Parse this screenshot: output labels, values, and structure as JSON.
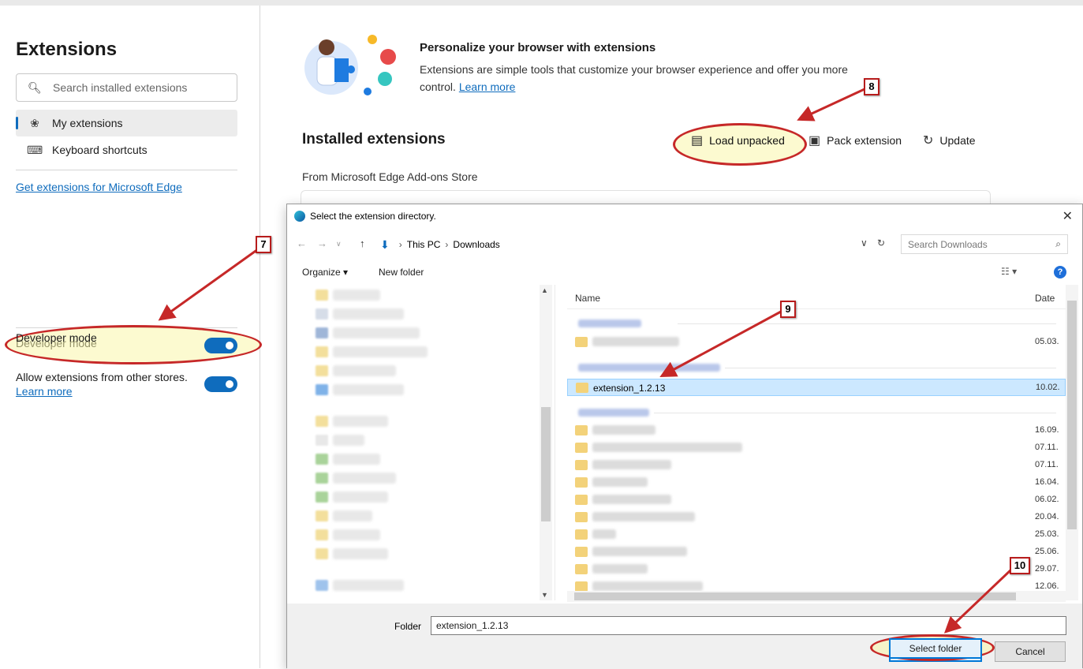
{
  "sidebar": {
    "title": "Extensions",
    "search_placeholder": "Search installed extensions",
    "items": [
      {
        "label": "My extensions",
        "icon": "puzzle-icon"
      },
      {
        "label": "Keyboard shortcuts",
        "icon": "keyboard-icon"
      }
    ],
    "get_link": "Get extensions for Microsoft Edge",
    "developer_mode": {
      "label": "Developer mode",
      "on": true
    },
    "allow_other": {
      "label": "Allow extensions from other stores.",
      "link": "Learn more",
      "on": true
    }
  },
  "main": {
    "hero_title": "Personalize your browser with extensions",
    "hero_desc": "Extensions are simple tools that customize your browser experience and offer you more control.",
    "hero_link": "Learn more",
    "installed_title": "Installed extensions",
    "load_unpacked": "Load unpacked",
    "pack_extension": "Pack extension",
    "update": "Update",
    "from_store": "From Microsoft Edge Add-ons Store"
  },
  "dialog": {
    "title": "Select the extension directory.",
    "path": [
      "This PC",
      "Downloads"
    ],
    "search_placeholder": "Search Downloads",
    "organize": "Organize ▾",
    "new_folder": "New folder",
    "col_name": "Name",
    "col_date": "Date",
    "selected_folder": "extension_1.2.13",
    "dates": [
      "05.03.",
      "10.02.",
      "16.09.",
      "07.11.",
      "07.11.",
      "16.04.",
      "06.02.",
      "20.04.",
      "25.03.",
      "25.06.",
      "29.07.",
      "12.06."
    ],
    "folder_label": "Folder",
    "folder_value": "extension_1.2.13",
    "select_button": "Select folder",
    "cancel_button": "Cancel"
  },
  "annotations": [
    "7",
    "8",
    "9",
    "10"
  ],
  "colors": {
    "accent": "#0f6cbd",
    "annotation": "#c62828",
    "highlight": "#faf5aa"
  }
}
